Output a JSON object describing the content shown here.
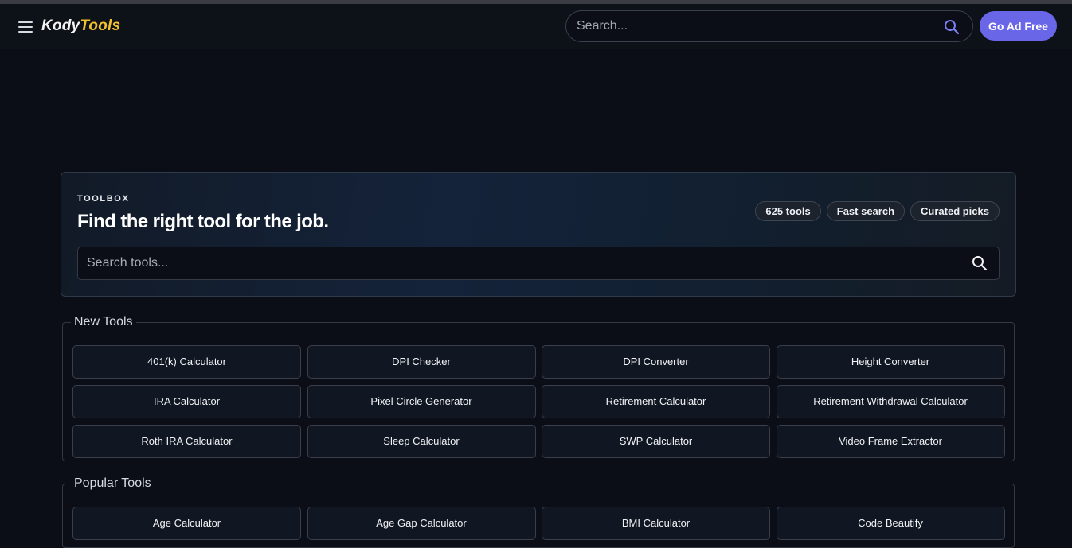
{
  "header": {
    "logo_part1": "Kody",
    "logo_part2": "Tools",
    "search_placeholder": "Search...",
    "go_ad_free": "Go Ad Free"
  },
  "hero": {
    "eyebrow": "TOOLBOX",
    "headline": "Find the right tool for the job.",
    "chips": [
      "625 tools",
      "Fast search",
      "Curated picks"
    ],
    "search_placeholder": "Search tools..."
  },
  "sections": {
    "new_tools": {
      "title": "New Tools",
      "items": [
        "401(k) Calculator",
        "DPI Checker",
        "DPI Converter",
        "Height Converter",
        "IRA Calculator",
        "Pixel Circle Generator",
        "Retirement Calculator",
        "Retirement Withdrawal Calculator",
        "Roth IRA Calculator",
        "Sleep Calculator",
        "SWP Calculator",
        "Video Frame Extractor"
      ]
    },
    "popular_tools": {
      "title": "Popular Tools",
      "items": [
        "Age Calculator",
        "Age Gap Calculator",
        "BMI Calculator",
        "Code Beautify"
      ]
    }
  },
  "colors": {
    "background": "#0b0e16",
    "accent": "#6966e8",
    "logo_yellow": "#f2c12e",
    "search_icon_accent": "#7b7ff0"
  },
  "icons": {
    "menu": "hamburger-menu-icon",
    "search": "search-icon"
  }
}
